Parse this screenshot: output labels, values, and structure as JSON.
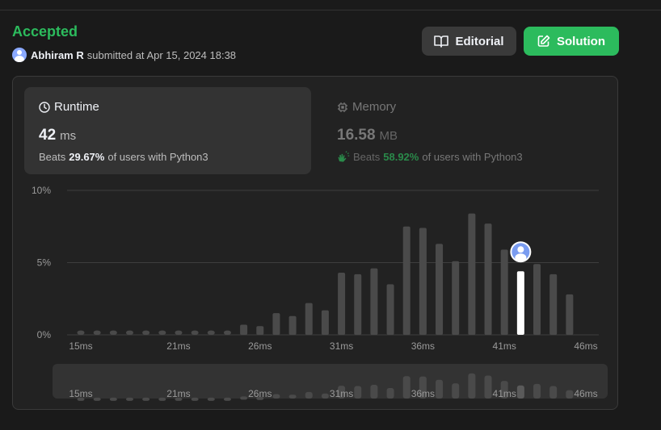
{
  "header": {
    "status": "Accepted",
    "user": "Abhiram R",
    "submitted_text": "submitted at Apr 15, 2024 18:38",
    "editorial_label": "Editorial",
    "solution_label": "Solution"
  },
  "runtime": {
    "title": "Runtime",
    "value": "42",
    "unit": "ms",
    "beats_prefix": "Beats",
    "beats_pct": "29.67%",
    "beats_suffix": "of users with Python3"
  },
  "memory": {
    "title": "Memory",
    "value": "16.58",
    "unit": "MB",
    "beats_prefix": "Beats",
    "beats_pct": "58.92%",
    "beats_suffix": "of users with Python3"
  },
  "colors": {
    "accent": "#2cbb5d",
    "bar": "#4a4a4a",
    "highlight": "#ffffff"
  },
  "chart_data": {
    "type": "bar",
    "xlabel": "",
    "ylabel": "",
    "ylim": [
      0,
      10
    ],
    "y_ticks": [
      "10%",
      "5%",
      "0%"
    ],
    "y_tick_values": [
      10,
      5,
      0
    ],
    "x_ticks": [
      "15ms",
      "21ms",
      "26ms",
      "31ms",
      "36ms",
      "41ms",
      "46ms"
    ],
    "x_tick_values": [
      15,
      21,
      26,
      31,
      36,
      41,
      46
    ],
    "x": [
      15,
      16,
      17,
      18,
      19,
      20,
      21,
      22,
      23,
      24,
      25,
      26,
      27,
      28,
      29,
      30,
      31,
      32,
      33,
      34,
      35,
      36,
      37,
      38,
      39,
      40,
      41,
      42,
      43,
      44,
      45,
      46
    ],
    "values": [
      0.3,
      0.3,
      0.3,
      0.3,
      0.3,
      0.3,
      0.3,
      0.3,
      0.3,
      0.3,
      0.7,
      0.6,
      1.5,
      1.3,
      2.2,
      1.7,
      4.3,
      4.2,
      4.6,
      3.5,
      7.5,
      7.4,
      6.3,
      5.1,
      8.4,
      7.7,
      5.9,
      4.4,
      4.9,
      4.2,
      2.8,
      0.0
    ],
    "highlight_x": 42,
    "grid": true
  }
}
